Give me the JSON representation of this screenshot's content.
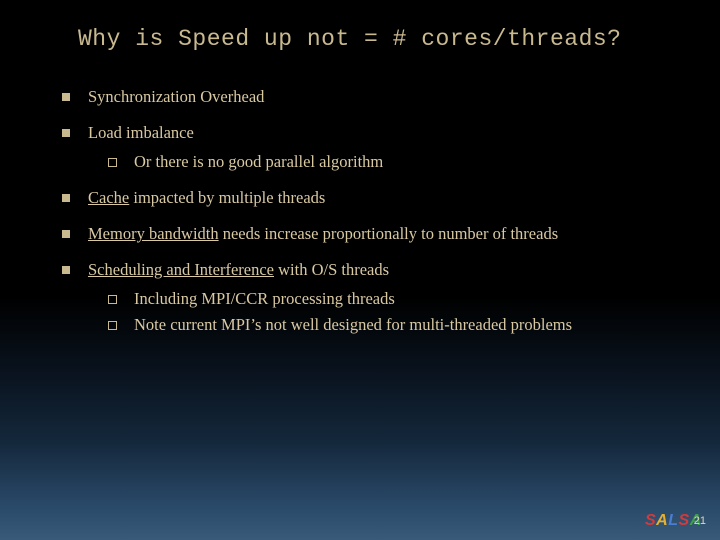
{
  "title": "Why is Speed up not = # cores/threads?",
  "bullets": {
    "b0": "Synchronization Overhead",
    "b1": "Load imbalance",
    "b1_0": "Or there is no good parallel algorithm",
    "b2_pre": "Cache",
    "b2_rest": " impacted by multiple threads",
    "b3_pre": "Memory bandwidth",
    "b3_rest": " needs increase proportionally to number of threads",
    "b4_pre": "Scheduling and Interference",
    "b4_rest": " with O/S threads",
    "b4_0": "Including MPI/CCR processing threads",
    "b4_1": "Note current MPI’s not well designed for multi-threaded problems"
  },
  "footer": {
    "logo": {
      "c0": "S",
      "c1": "A",
      "c2": "L",
      "c3": "S",
      "c4": "A"
    },
    "page": "21"
  }
}
